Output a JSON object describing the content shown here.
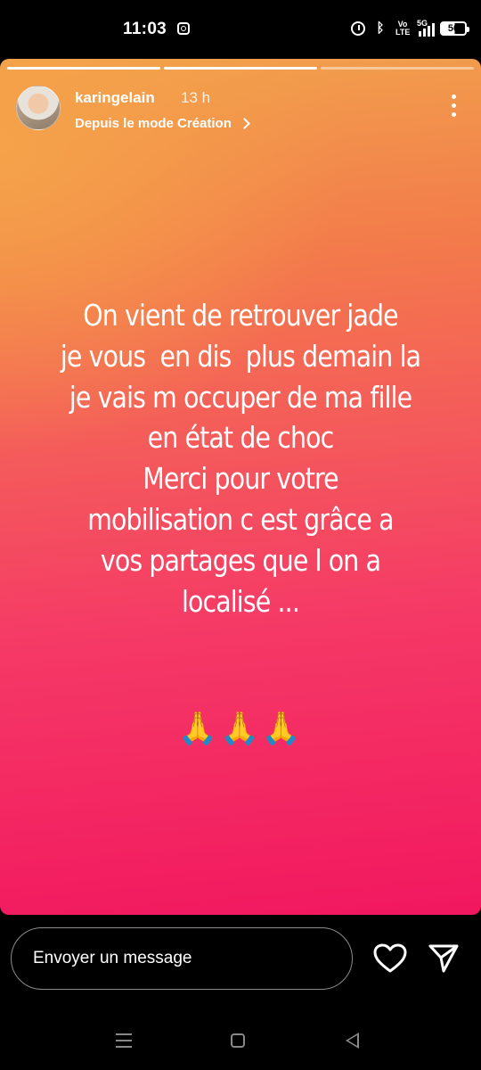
{
  "status_bar": {
    "time": "11:03",
    "battery_percent": "56",
    "network": "5G",
    "volte_label": "Vo\nLTE",
    "icons": [
      "instagram-icon",
      "alarm-icon",
      "bluetooth-icon",
      "volte-icon",
      "signal-icon",
      "battery-icon"
    ]
  },
  "story": {
    "progress": {
      "total_segments": 3,
      "completed_segments": 2
    },
    "username": "karingelain",
    "time_ago": "13 h",
    "subtitle": "Depuis le mode Création",
    "text_lines": [
      "On vient de retrouver jade",
      "je vous  en dis  plus demain la",
      "je vais m occuper de ma fille",
      "en état de choc",
      "Merci pour votre",
      "mobilisation c est grâce a",
      "vos partages que l on a",
      "localisé ..."
    ],
    "emoji_line": "🙏🙏🙏",
    "colors": {
      "gradient_top": "#f1a24c",
      "gradient_mid": "#f45a5b",
      "gradient_bottom": "#f2175f"
    }
  },
  "reply_bar": {
    "placeholder": "Envoyer un message",
    "icons": [
      "heart-icon",
      "send-icon"
    ]
  },
  "nav_bar": {
    "icons": [
      "recent-apps-icon",
      "home-icon",
      "back-icon"
    ]
  }
}
